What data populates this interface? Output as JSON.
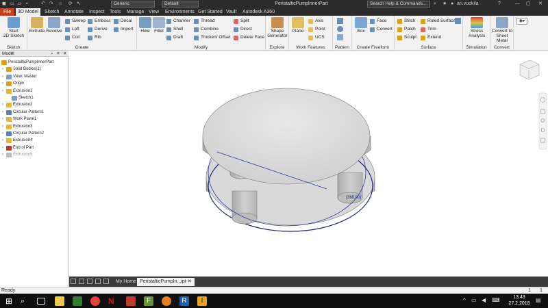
{
  "window": {
    "title": "PeristalticPumpInnerPart",
    "search_placeholder": "Search Help & Commands...",
    "user": "ari.vuokila",
    "appearance_combo": "Generic",
    "material_combo": "Default"
  },
  "tabs": [
    "File",
    "3D Model",
    "Sketch",
    "Annotate",
    "Inspect",
    "Tools",
    "Manage",
    "View",
    "Environments",
    "Get Started",
    "Vault",
    "Autodesk A360"
  ],
  "ribbon": {
    "sketch": {
      "label": "Sketch",
      "start": "Start",
      "start2": "2D Sketch"
    },
    "create": {
      "label": "Create",
      "extrude": "Extrude",
      "revolve": "Revolve",
      "sweep": "Sweep",
      "loft": "Loft",
      "coil": "Coil",
      "emboss": "Emboss",
      "derive": "Derive",
      "rib": "Rib",
      "decal": "Decal",
      "import": "Import"
    },
    "modify": {
      "label": "Modify",
      "hole": "Hole",
      "fillet": "Fillet",
      "chamfer": "Chamfer",
      "shell": "Shell",
      "draft": "Draft",
      "thread": "Thread",
      "combine": "Combine",
      "thicken": "Thicken/ Offset",
      "split": "Split",
      "direct": "Direct",
      "delete_face": "Delete Face"
    },
    "explore": {
      "label": "Explore",
      "shape": "Shape",
      "shape2": "Generator"
    },
    "work_features": {
      "label": "Work Features",
      "plane": "Plane",
      "axis": "Axis",
      "point": "Point",
      "ucs": "UCS"
    },
    "pattern": {
      "label": "Pattern"
    },
    "create_freeform": {
      "label": "Create Freeform",
      "box": "Box",
      "face": "Face",
      "convert": "Convert"
    },
    "surface": {
      "label": "Surface",
      "stitch": "Stitch",
      "patch": "Patch",
      "sculpt": "Sculpt",
      "ruled": "Ruled Surface",
      "trim": "Trim",
      "extend": "Extend"
    },
    "simulation": {
      "label": "Simulation",
      "stress": "Stress",
      "stress2": "Analysis"
    },
    "convert": {
      "label": "Convert",
      "sheet": "Convert to",
      "sheet2": "Sheet Metal"
    }
  },
  "browser": {
    "header": "Model",
    "tree": [
      {
        "label": "PeristalticPumpInnerPart",
        "level": 0,
        "color": "#d9a21b"
      },
      {
        "label": "Solid Bodies(1)",
        "level": 1,
        "color": "#d9a21b"
      },
      {
        "label": "View: Master",
        "level": 1,
        "color": "#7a9ec8"
      },
      {
        "label": "Origin",
        "level": 1,
        "color": "#d9a21b"
      },
      {
        "label": "Extrusion1",
        "level": 1,
        "color": "#e3b83a"
      },
      {
        "label": "Sketch1",
        "level": 2,
        "color": "#7a9ec8"
      },
      {
        "label": "Extrusion2",
        "level": 1,
        "color": "#e3b83a"
      },
      {
        "label": "Circular Pattern1",
        "level": 1,
        "color": "#5b7fae"
      },
      {
        "label": "Work Plane1",
        "level": 1,
        "color": "#e3b83a"
      },
      {
        "label": "Extrusion3",
        "level": 1,
        "color": "#e3b83a"
      },
      {
        "label": "Circular Pattern2",
        "level": 1,
        "color": "#5b7fae"
      },
      {
        "label": "Extrusion4",
        "level": 1,
        "color": "#e3b83a"
      },
      {
        "label": "End of Part",
        "level": 1,
        "color": "#c0392b"
      },
      {
        "label": "Extrusion5",
        "level": 1,
        "color": "#bbbbbb",
        "dim": true
      }
    ]
  },
  "viewport": {
    "dimension_label": "(360,00)"
  },
  "doc_tabs": {
    "home": "My Home",
    "part": "PeristalticPumpIn...ipt"
  },
  "status": {
    "text": "Ready",
    "count1": "1",
    "count2": "1"
  },
  "taskbar": {
    "time": "13.43",
    "date": "27.2.2018"
  }
}
